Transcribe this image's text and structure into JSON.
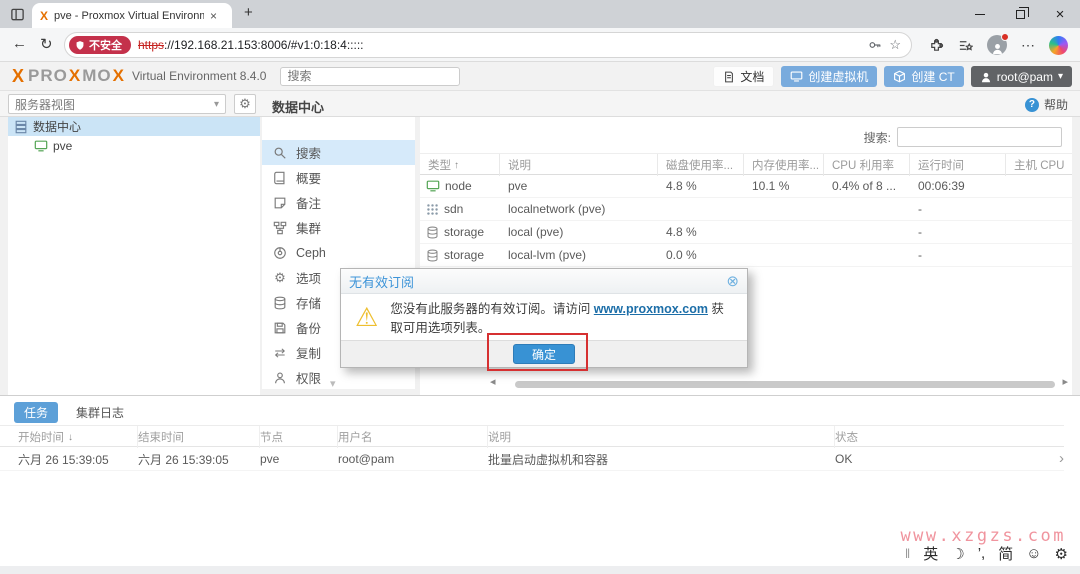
{
  "glyphs": {
    "proxmox_x": "X",
    "close_x": "×",
    "plus": "+",
    "back": "←",
    "refresh": "↻",
    "star": "☆",
    "more": "⋯",
    "caret_down": "▾",
    "sort_asc": "↑",
    "sort_desc": "↓",
    "dialog_close": "⊗",
    "warning": "⚠",
    "gear": "⚙",
    "replication": "⇄",
    "chevron_right": "›",
    "scroll_left": "◂",
    "scroll_right": "▸",
    "help_q": "?",
    "ime_handle": "‖",
    "ime_lang": "英",
    "ime_moon": "☽",
    "ime_punct": "’,",
    "ime_simplified": "简",
    "ime_smiley": "☺",
    "ime_gear": "⚙"
  },
  "browser": {
    "tab_title": "pve - Proxmox Virtual Environme",
    "address": {
      "badge": "不安全",
      "scheme": "https",
      "rest": "://192.168.21.153:8006/#v1:0:18:4:::::"
    }
  },
  "masthead": {
    "logo_segments": [
      "PRO",
      "X",
      "MO",
      "X"
    ],
    "product": "Virtual Environment 8.4.0",
    "search_placeholder": "搜索",
    "docs_label": "文档",
    "create_vm_label": "创建虚拟机",
    "create_ct_label": "创建 CT",
    "user_label": "root@pam"
  },
  "subheader": {
    "view_label": "服务器视图",
    "page_title": "数据中心",
    "help_label": "帮助"
  },
  "tree": {
    "items": [
      {
        "label": "数据中心"
      },
      {
        "label": "pve"
      }
    ]
  },
  "nav": {
    "items": [
      {
        "label": "搜索"
      },
      {
        "label": "概要"
      },
      {
        "label": "备注"
      },
      {
        "label": "集群"
      },
      {
        "label": "Ceph"
      },
      {
        "label": "选项"
      },
      {
        "label": "存储"
      },
      {
        "label": "备份"
      },
      {
        "label": "复制"
      },
      {
        "label": "权限"
      }
    ]
  },
  "main": {
    "filter_label": "搜索:",
    "table": {
      "headers": {
        "type": "类型",
        "desc": "说明",
        "disk": "磁盘使用率...",
        "mem": "内存使用率...",
        "cpu": "CPU 利用率",
        "uptime": "运行时间",
        "hostcpu": "主机 CPU"
      },
      "rows": [
        {
          "type": "node",
          "desc": "pve",
          "disk": "4.8 %",
          "mem": "10.1 %",
          "cpu": "0.4% of 8 ...",
          "uptime": "00:06:39"
        },
        {
          "type": "sdn",
          "desc": "localnetwork (pve)",
          "disk": "",
          "mem": "",
          "cpu": "",
          "uptime": "-"
        },
        {
          "type": "storage",
          "desc": "local (pve)",
          "disk": "4.8 %",
          "mem": "",
          "cpu": "",
          "uptime": "-"
        },
        {
          "type": "storage",
          "desc": "local-lvm (pve)",
          "disk": "0.0 %",
          "mem": "",
          "cpu": "",
          "uptime": "-"
        }
      ]
    }
  },
  "dialog": {
    "title": "无有效订阅",
    "message_pre": "您没有此服务器的有效订阅。请访问 ",
    "link": "www.proxmox.com",
    "message_post": " 获取可用选项列表。",
    "ok_label": "确定"
  },
  "tasks": {
    "tab_tasks": "任务",
    "tab_cluster_log": "集群日志",
    "headers": {
      "start": "开始时间",
      "end": "结束时间",
      "node": "节点",
      "user": "用户名",
      "desc": "说明",
      "status": "状态"
    },
    "rows": [
      {
        "start": "六月 26 15:39:05",
        "end": "六月 26 15:39:05",
        "node": "pve",
        "user": "root@pam",
        "desc": "批量启动虚拟机和容器",
        "status": "OK"
      }
    ]
  },
  "watermark": "www.xzgzs.com",
  "colors": {
    "accent_blue": "#3892d4",
    "badge_red": "#c4314b",
    "annotation_red": "#d63031",
    "watermark_pink": "#f0949e",
    "proxmox_orange": "#e57000",
    "link_blue": "#1c6ea8"
  }
}
